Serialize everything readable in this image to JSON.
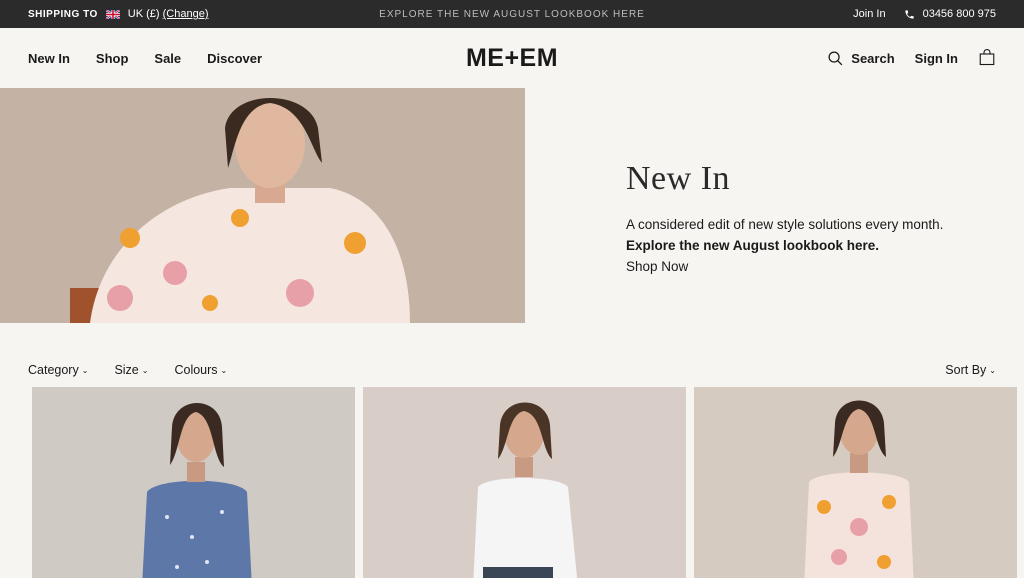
{
  "topbar": {
    "shipping_label": "SHIPPING TO",
    "region": "UK (£)",
    "change": "(Change)",
    "promo": "EXPLORE THE NEW AUGUST LOOKBOOK HERE",
    "join": "Join In",
    "phone": "03456 800 975"
  },
  "nav": {
    "items": [
      "New In",
      "Shop",
      "Sale",
      "Discover"
    ],
    "logo": "ME+EM",
    "search": "Search",
    "sign_in": "Sign In"
  },
  "hero": {
    "title": "New In",
    "description": "A considered edit of new style solutions every month.",
    "bold_line": "Explore the new August lookbook here.",
    "cta": "Shop Now"
  },
  "filters": {
    "category": "Category",
    "size": "Size",
    "colours": "Colours",
    "sort": "Sort By"
  },
  "colors": {
    "topbar_bg": "#2b2b2b",
    "page_bg": "#f7f5f1"
  }
}
